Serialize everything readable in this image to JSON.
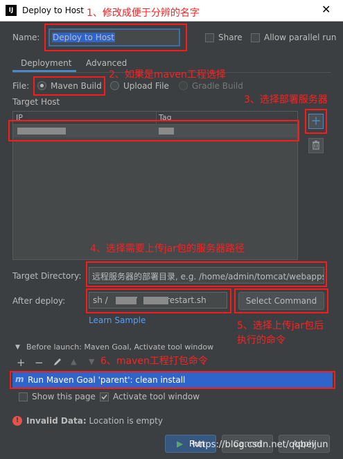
{
  "window": {
    "title": "Deploy to Host",
    "app_icon": "IJ"
  },
  "annotations": {
    "a1": "1、修改成便于分辨的名字",
    "a2": "2、如果是maven工程选择",
    "a3": "3、选择部署服务器",
    "a4": "4、选择需要上传jar包的服务器路径",
    "a5_line1": "5、选择上传jar包后",
    "a5_line2": "执行的命令",
    "a6": "6、maven工程打包命令"
  },
  "form": {
    "name_label": "Name:",
    "name_value": "Deploy to Host",
    "share_label": "Share",
    "parallel_label": "Allow parallel run",
    "tabs": [
      "Deployment",
      "Advanced"
    ],
    "file_label": "File:",
    "file_options": [
      "Maven Build",
      "Upload File",
      "Gradle Build"
    ],
    "file_selected": "Maven Build",
    "target_host_label": "Target Host",
    "table_headers": [
      "IP",
      "Tag"
    ],
    "target_dir_label": "Target Directory:",
    "target_dir_value": "远程服务器的部署目录, e.g. /home/admin/tomcat/webapps",
    "after_deploy_label": "After deploy:",
    "after_deploy_value": "sh /          /          /restart.sh",
    "select_command": "Select Command",
    "learn_sample": "Learn Sample"
  },
  "before_launch": {
    "header": "Before launch: Maven Goal, Activate tool window",
    "task": "Run Maven Goal 'parent': clean install",
    "show_page": "Show this page",
    "activate_window": "Activate tool window",
    "activate_checked": true
  },
  "status": {
    "error_bold": "Invalid Data:",
    "error_text": "Location is empty"
  },
  "buttons": {
    "run": "Run",
    "cancel": "Cancel",
    "apply": "Apply"
  },
  "watermark": "https://blog.csdn.net/qqbeijun",
  "colors": {
    "accent": "#4a88c7",
    "annotation": "#ff2020",
    "error": "#e5534b",
    "selected_row": "#2f65ca"
  }
}
